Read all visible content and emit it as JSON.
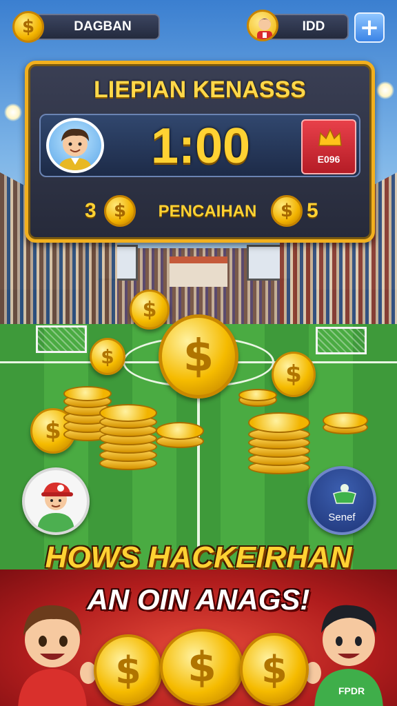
{
  "top_bar": {
    "currency_label": "DAGBAN",
    "coin_icon": "dollar-coin-icon",
    "opponent_label": "IDD",
    "add_button_symbol": "+"
  },
  "scoreboard": {
    "title": "LIEPIAN KENASSS",
    "timer": "1:00",
    "rank_value": "E096",
    "rank_icon": "crown-icon",
    "left_score": "3",
    "right_score": "5",
    "score_label": "PENCAIHAN"
  },
  "field": {
    "coin_symbol": "$"
  },
  "side_buttons": {
    "senef_label": "Senef"
  },
  "banner": {
    "headline_1": "HOWS HACKEIRHAN",
    "headline_2": "AN OIN ANAGS!",
    "right_kid_shirt": "FPDR"
  },
  "colors": {
    "gold": "#ffd233",
    "board_border": "#f2b01e",
    "banner_red": "#b11d1d",
    "pitch_green": "#4aab42"
  }
}
